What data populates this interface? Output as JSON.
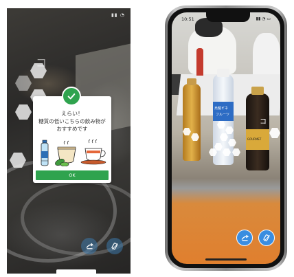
{
  "left_screen": {
    "dialog": {
      "title": "えらい！",
      "message": "糖質の低いこちらの飲み物がおすすめです",
      "ok_label": "OK",
      "accent_color": "#2fa34e"
    },
    "overlay_text": "コ",
    "icons": [
      "check-icon",
      "water-bottle-icon",
      "tea-cup-icon",
      "coffee-cup-icon",
      "share-icon",
      "camera-icon"
    ]
  },
  "right_screen": {
    "status_time": "10:51",
    "overlay_text": "コ",
    "bottle_labels": {
      "middle": "烏龍ビネ",
      "middle_sub": "フルーツ",
      "right": "GOURMET"
    },
    "icons": [
      "share-icon",
      "camera-icon"
    ],
    "fab_color": "#3a8de0"
  }
}
